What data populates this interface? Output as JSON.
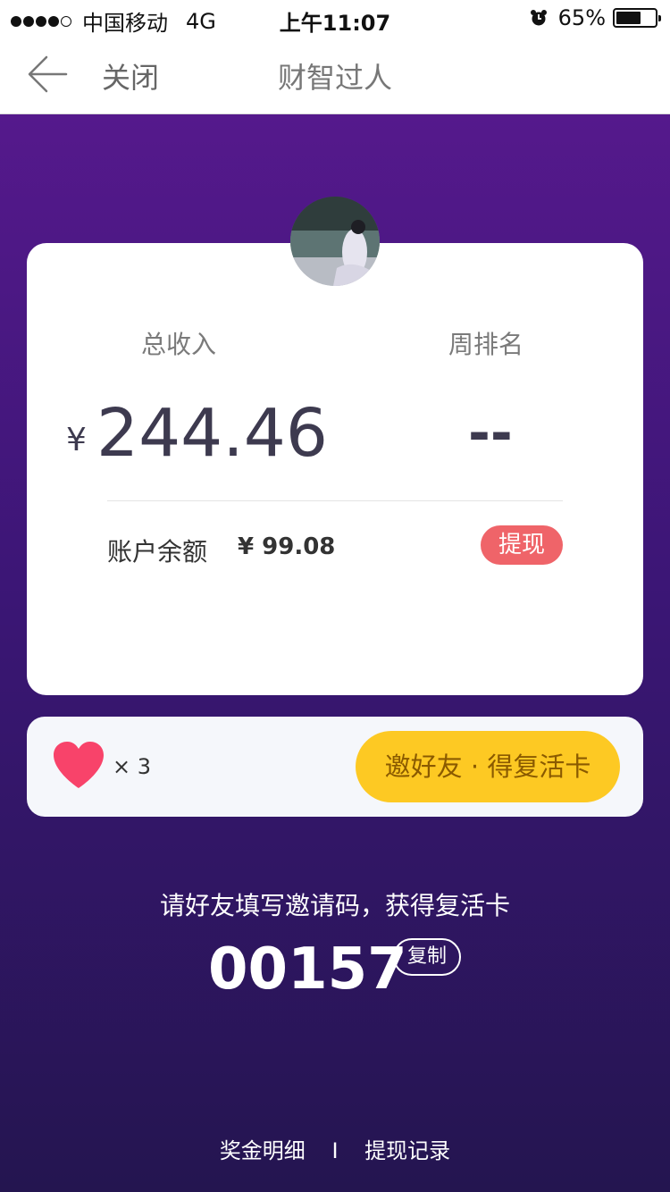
{
  "status_bar": {
    "carrier": "中国移动",
    "network": "4G",
    "time": "上午11:07",
    "battery_percent": "65%",
    "battery_level": 0.65,
    "signal_strength": 4,
    "alarm_icon": "alarm-clock-icon"
  },
  "nav": {
    "back_icon": "back-arrow-icon",
    "close_label": "关闭",
    "title": "财智过人"
  },
  "stats": {
    "income_label": "总收入",
    "rank_label": "周排名",
    "currency_symbol": "¥",
    "income_value": "244.46",
    "rank_value": "--",
    "balance_label": "账户余额",
    "balance_value": "¥ 99.08",
    "withdraw_label": "提现"
  },
  "lives": {
    "icon": "heart-icon",
    "count_text": "× 3",
    "invite_label": "邀好友 · 得复活卡"
  },
  "invite": {
    "hint": "请好友填写邀请码，获得复活卡",
    "code": "00157",
    "copy_label": "复制"
  },
  "footer": {
    "bonus_detail": "奖金明细",
    "separator": "I",
    "withdraw_records": "提现记录"
  },
  "colors": {
    "gradient_top": "#55198c",
    "gradient_bottom": "#241550",
    "withdraw_red": "#ef6469",
    "invite_yellow": "#fdc923",
    "heart_pink": "#f8436a"
  }
}
